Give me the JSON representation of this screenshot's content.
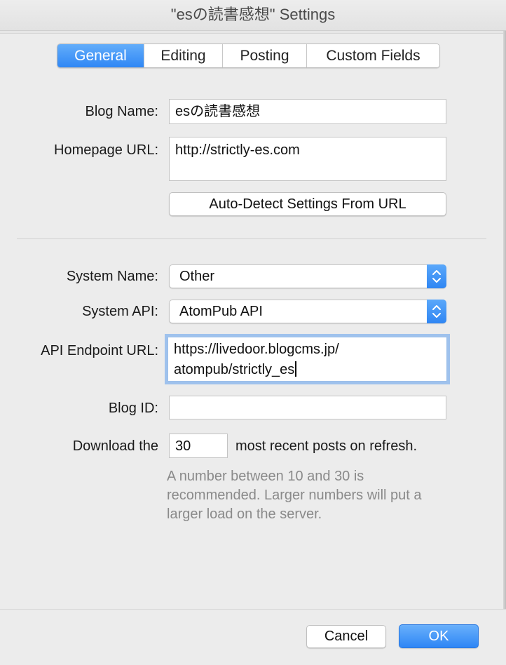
{
  "window": {
    "title": "\"esの読書感想\" Settings"
  },
  "tabs": [
    {
      "label": "General",
      "active": true
    },
    {
      "label": "Editing",
      "active": false
    },
    {
      "label": "Posting",
      "active": false
    },
    {
      "label": "Custom Fields",
      "active": false
    }
  ],
  "form": {
    "blog_name_label": "Blog Name:",
    "blog_name_value": "esの読書感想",
    "homepage_url_label": "Homepage URL:",
    "homepage_url_value": "http://strictly-es.com",
    "auto_detect_label": "Auto-Detect Settings From URL",
    "system_name_label": "System Name:",
    "system_name_value": "Other",
    "system_api_label": "System API:",
    "system_api_value": "AtomPub API",
    "api_endpoint_label": "API Endpoint URL:",
    "api_endpoint_line1": "https://livedoor.blogcms.jp/",
    "api_endpoint_line2": "atompub/strictly_es",
    "blog_id_label": "Blog ID:",
    "blog_id_value": "",
    "download_prefix": "Download the",
    "download_value": "30",
    "download_suffix": "most recent posts on refresh.",
    "hint": "A number between 10 and 30 is recommended. Larger numbers will put a larger load on the server."
  },
  "footer": {
    "cancel_label": "Cancel",
    "ok_label": "OK"
  },
  "colors": {
    "accent": "#2f87f5",
    "focus_ring": "#9fc2ed"
  }
}
